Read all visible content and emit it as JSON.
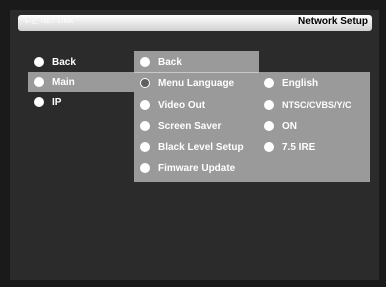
{
  "header": {
    "brand": "NET LINK",
    "title": "Network Setup"
  },
  "left_menu": [
    {
      "label": "Back"
    },
    {
      "label": "Main"
    },
    {
      "label": "IP"
    }
  ],
  "sub_menu": [
    {
      "label": "Back"
    },
    {
      "label": "Menu Language"
    },
    {
      "label": "Video Out"
    },
    {
      "label": "Screen Saver"
    },
    {
      "label": "Black Level Setup"
    },
    {
      "label": "Fimware Update"
    }
  ],
  "values": [
    {
      "label": "English"
    },
    {
      "label": "NTSC/CVBS/Y/C"
    },
    {
      "label": "ON"
    },
    {
      "label": "7.5 IRE"
    }
  ]
}
